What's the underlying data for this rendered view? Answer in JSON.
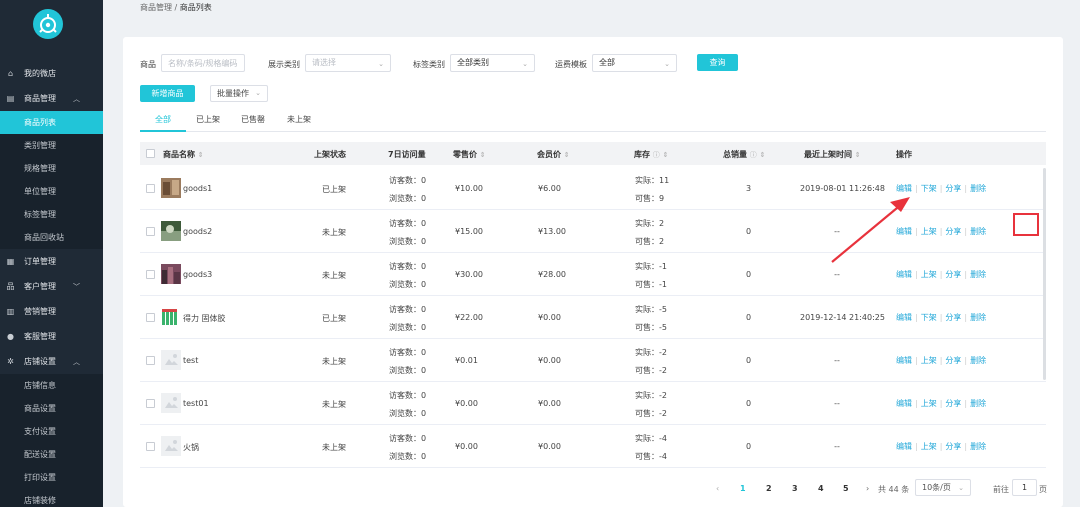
{
  "breadcrumb": {
    "parent": "商品管理",
    "sep": " / ",
    "current": "商品列表"
  },
  "sidebar": {
    "top1": "我的微店",
    "top2": "商品管理",
    "sub2": [
      "商品列表",
      "类别管理",
      "规格管理",
      "单位管理",
      "标签管理",
      "商品回收站"
    ],
    "top3": "订单管理",
    "top4": "客户管理",
    "top5": "营销管理",
    "top6": "客服管理",
    "top7": "店铺设置",
    "sub7": [
      "店铺信息",
      "商品设置",
      "支付设置",
      "配送设置",
      "打印设置",
      "店铺装修"
    ]
  },
  "filters": {
    "goods_label": "商品",
    "goods_placeholder": "名称/条码/规格编码",
    "display_label": "展示类别",
    "display_placeholder": "请选择",
    "tag_label": "标签类别",
    "tag_value": "全部类别",
    "shipping_label": "运费模板",
    "shipping_value": "全部",
    "query_button": "查询"
  },
  "toolbar": {
    "add_button": "新增商品",
    "batch_button": "批量操作"
  },
  "tabs": [
    "全部",
    "已上架",
    "已售罄",
    "未上架"
  ],
  "columns": {
    "name": "商品名称",
    "status": "上架状态",
    "visits": "7日访问量",
    "retail": "零售价",
    "member": "会员价",
    "stock": "库存",
    "sales": "总销量",
    "last_time": "最近上架时间",
    "ops": "操作"
  },
  "labels": {
    "visitors": "访客数：",
    "views": "浏览数：",
    "actual": "实际：",
    "available": "可售："
  },
  "rows": [
    {
      "name": "goods1",
      "status": "已上架",
      "visitors": "0",
      "views": "0",
      "retail": "¥10.00",
      "member": "¥6.00",
      "actual": "11",
      "available": "9",
      "sales": "3",
      "time": "2019-08-01 11:26:48",
      "toggle": "下架"
    },
    {
      "name": "goods2",
      "status": "未上架",
      "visitors": "0",
      "views": "0",
      "retail": "¥15.00",
      "member": "¥13.00",
      "actual": "2",
      "available": "2",
      "sales": "0",
      "time": "--",
      "toggle": "上架"
    },
    {
      "name": "goods3",
      "status": "未上架",
      "visitors": "0",
      "views": "0",
      "retail": "¥30.00",
      "member": "¥28.00",
      "actual": "-1",
      "available": "-1",
      "sales": "0",
      "time": "--",
      "toggle": "上架"
    },
    {
      "name": "得力 固体胶",
      "status": "已上架",
      "visitors": "0",
      "views": "0",
      "retail": "¥22.00",
      "member": "¥0.00",
      "actual": "-5",
      "available": "-5",
      "sales": "0",
      "time": "2019-12-14 21:40:25",
      "toggle": "下架"
    },
    {
      "name": "test",
      "status": "未上架",
      "visitors": "0",
      "views": "0",
      "retail": "¥0.01",
      "member": "¥0.00",
      "actual": "-2",
      "available": "-2",
      "sales": "0",
      "time": "--",
      "toggle": "上架"
    },
    {
      "name": "test01",
      "status": "未上架",
      "visitors": "0",
      "views": "0",
      "retail": "¥0.00",
      "member": "¥0.00",
      "actual": "-2",
      "available": "-2",
      "sales": "0",
      "time": "--",
      "toggle": "上架"
    },
    {
      "name": "火锅",
      "status": "未上架",
      "visitors": "0",
      "views": "0",
      "retail": "¥0.00",
      "member": "¥0.00",
      "actual": "-4",
      "available": "-4",
      "sales": "0",
      "time": "--",
      "toggle": "上架"
    }
  ],
  "actions": {
    "edit": "编辑",
    "share": "分享",
    "delete": "删除"
  },
  "pagination": {
    "pages": [
      "1",
      "2",
      "3",
      "4",
      "5"
    ],
    "total": "共 44 条",
    "page_size": "10条/页",
    "goto_label": "前往",
    "goto_value": "1",
    "page_unit": "页"
  },
  "colors": {
    "accent": "#21c5d8",
    "sidebar": "#1f2a36",
    "link": "#21a7d8",
    "highlight": "#e8323c"
  }
}
